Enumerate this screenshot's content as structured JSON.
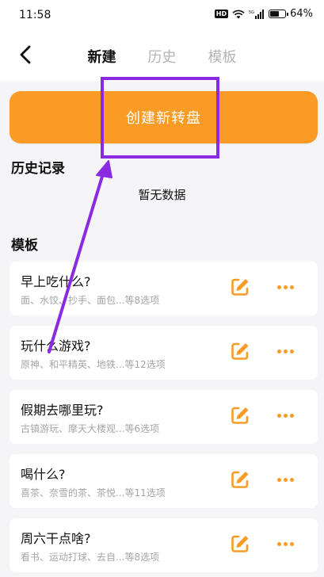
{
  "status_bar": {
    "time": "11:58",
    "hd_label": "HD",
    "battery": "64%",
    "battery_level": 0.64
  },
  "nav": {
    "tabs": [
      {
        "label": "新建",
        "active": true
      },
      {
        "label": "历史",
        "active": false
      },
      {
        "label": "模板",
        "active": false
      }
    ]
  },
  "create_button": {
    "label": "创建新转盘"
  },
  "history": {
    "title": "历史记录",
    "empty_text": "暂无数据"
  },
  "templates": {
    "title": "模板",
    "items": [
      {
        "title": "早上吃什么?",
        "subtitle": "面、水饺、抄手、面包...等8选项"
      },
      {
        "title": "玩什么游戏?",
        "subtitle": "原神、和平精英、地铁...等12选项"
      },
      {
        "title": "假期去哪里玩?",
        "subtitle": "古镇游玩、摩天大楼观...等6选项"
      },
      {
        "title": "喝什么?",
        "subtitle": "喜茶、奈雪的茶、茶悦...等11选项"
      },
      {
        "title": "周六干点啥?",
        "subtitle": "看书、运动打球、去自...等8选项"
      }
    ]
  },
  "colors": {
    "accent": "#f99b25",
    "annotation": "#8a2be2",
    "background": "#f5f5f7"
  }
}
